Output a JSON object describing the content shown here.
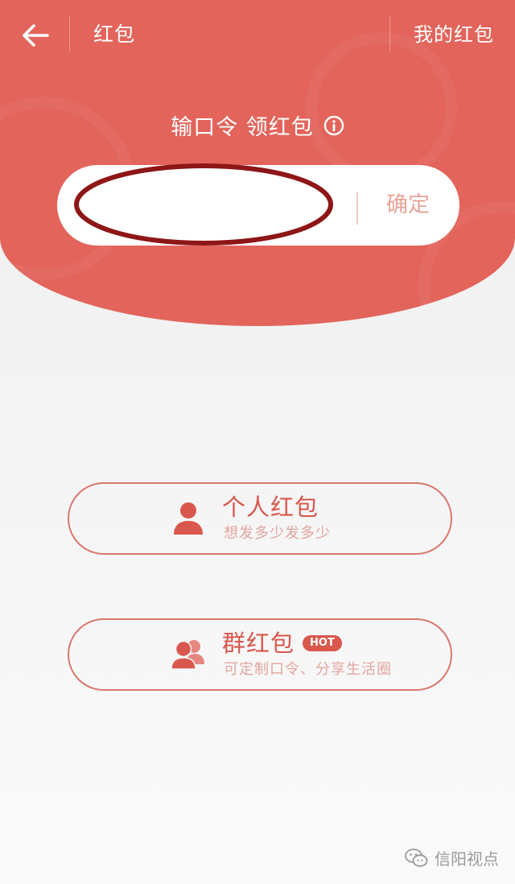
{
  "topbar": {
    "back_icon": "arrow-left-icon",
    "title": "红包",
    "my_link": "我的红包"
  },
  "hero": {
    "prompt": "输口令 领红包",
    "info_icon": "info-icon",
    "input_value": "",
    "input_placeholder": "",
    "confirm_label": "确定"
  },
  "options": {
    "personal": {
      "icon": "person-icon",
      "title": "个人红包",
      "subtitle": "想发多少发多少"
    },
    "group": {
      "icon": "group-icon",
      "title": "群红包",
      "badge": "HOT",
      "subtitle": "可定制口令、分享生活圈"
    }
  },
  "watermark": {
    "icon": "wechat-icon",
    "text": "信阳视点"
  },
  "colors": {
    "hero_red": "#e2645b",
    "accent_red": "#d9574d",
    "confirm_text": "#e8a398",
    "annotation": "#8e1616"
  }
}
